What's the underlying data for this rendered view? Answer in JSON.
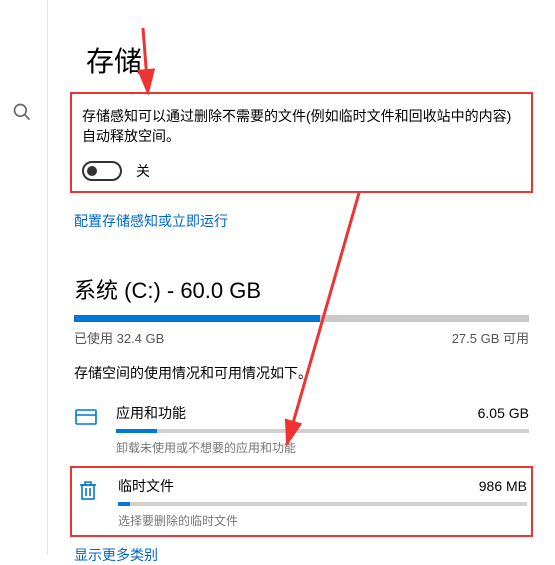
{
  "title": "存储",
  "sense": {
    "desc": "存储感知可以通过删除不需要的文件(例如临时文件和回收站中的内容)自动释放空间。",
    "toggle_state": "关",
    "link": "配置存储感知或立即运行"
  },
  "drive": {
    "label": "系统 (C:) - 60.0 GB",
    "used_label": "已使用 32.4 GB",
    "free_label": "27.5 GB 可用",
    "used_pct": 54,
    "subtitle": "存储空间的使用情况和可用情况如下。"
  },
  "cats": [
    {
      "icon": "apps",
      "name": "应用和功能",
      "size": "6.05 GB",
      "pct": 10,
      "hint": "卸载未使用或不想要的应用和功能"
    },
    {
      "icon": "trash",
      "name": "临时文件",
      "size": "986 MB",
      "pct": 3,
      "hint": "选择要删除的临时文件"
    }
  ],
  "more_link": "显示更多类别"
}
